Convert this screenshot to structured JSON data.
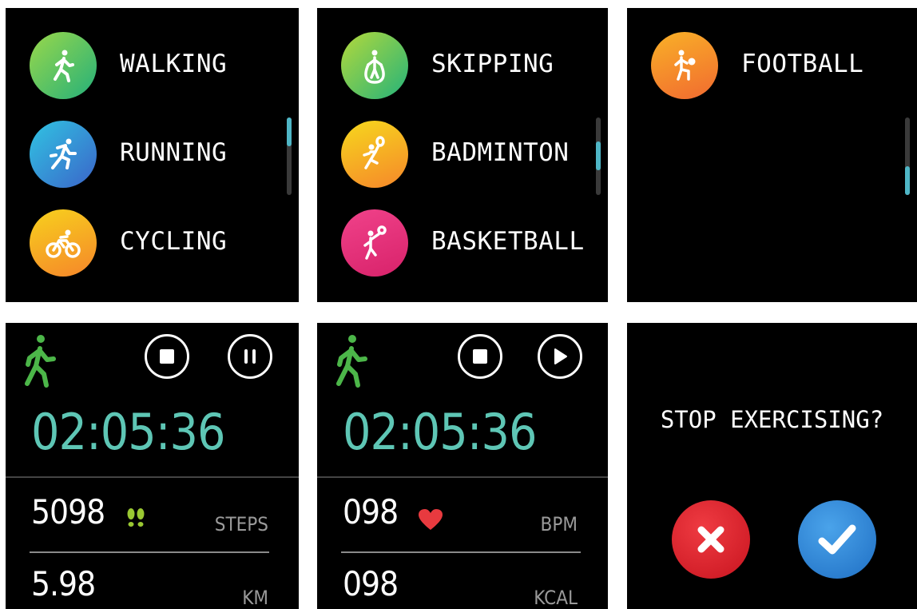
{
  "screen1": {
    "items": [
      {
        "label": "WALKING",
        "icon": "walking-icon"
      },
      {
        "label": "RUNNING",
        "icon": "running-icon"
      },
      {
        "label": "CYCLING",
        "icon": "cycling-icon"
      }
    ]
  },
  "screen2": {
    "items": [
      {
        "label": "SKIPPING",
        "icon": "skipping-icon"
      },
      {
        "label": "BADMINTON",
        "icon": "badminton-icon"
      },
      {
        "label": "BASKETBALL",
        "icon": "basketball-icon"
      }
    ]
  },
  "screen3": {
    "items": [
      {
        "label": "FOOTBALL",
        "icon": "football-icon"
      }
    ]
  },
  "screen4": {
    "time": "02:05:36",
    "metric1": {
      "value": "5098",
      "unit": "STEPS",
      "icon": "footprints-icon"
    },
    "metric2": {
      "value": "5.98",
      "unit": "KM"
    },
    "controls": [
      "stop-icon",
      "pause-icon"
    ]
  },
  "screen5": {
    "time": "02:05:36",
    "metric1": {
      "value": "098",
      "unit": "BPM",
      "icon": "heart-icon"
    },
    "metric2": {
      "value": "098",
      "unit": "KCAL"
    },
    "controls": [
      "stop-icon",
      "play-icon"
    ]
  },
  "screen6": {
    "question": "STOP EXERCISING?",
    "cancel_icon": "close-icon",
    "confirm_icon": "check-icon"
  },
  "colors": {
    "accent_time": "#5ec6b5",
    "scroll_thumb": "#4fb6c6",
    "walker_green": "#4cb649",
    "cancel_red": "#d8222e",
    "confirm_blue": "#2f86d6"
  }
}
